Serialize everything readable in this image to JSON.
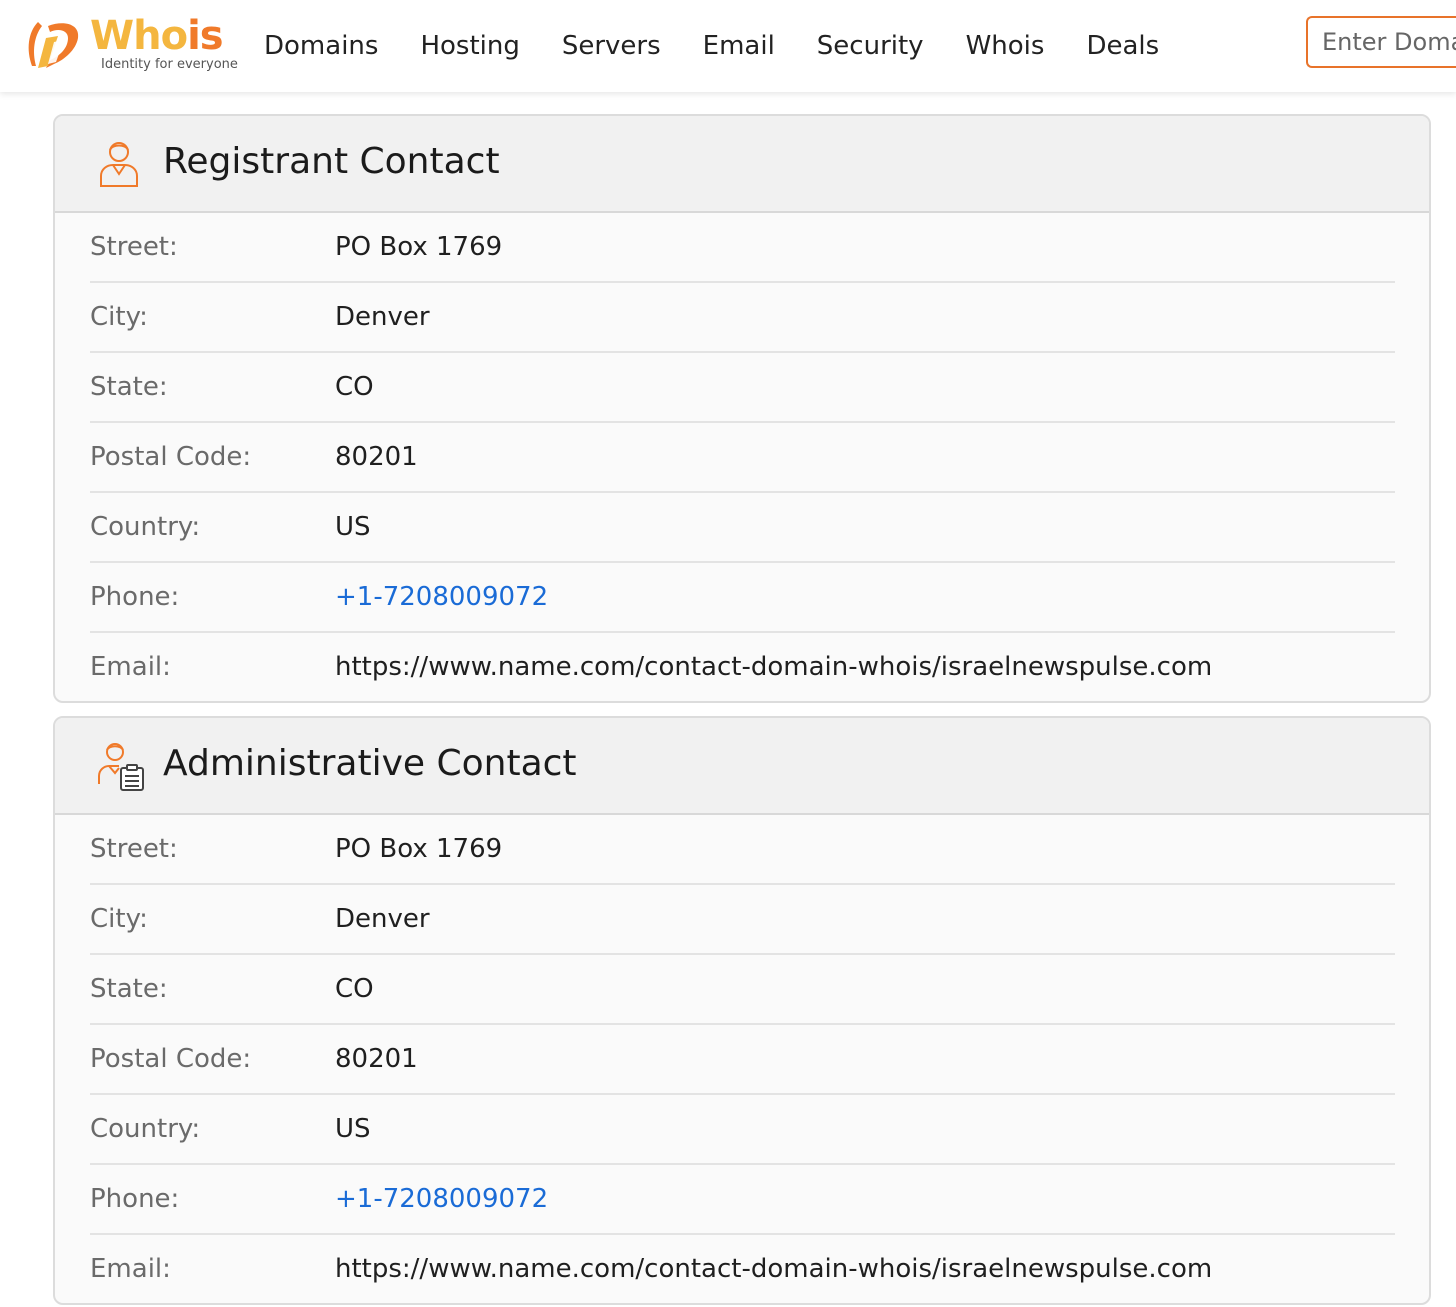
{
  "header": {
    "logo_text_main": "Who",
    "logo_text_accent": "is",
    "logo_tagline": "Identity for everyone",
    "nav": [
      "Domains",
      "Hosting",
      "Servers",
      "Email",
      "Security",
      "Whois",
      "Deals"
    ],
    "search_placeholder": "Enter Domain or IP"
  },
  "colors": {
    "accent": "#f07a2a",
    "logo_yellow": "#f4b63f",
    "link": "#1a6bd6"
  },
  "sections": [
    {
      "title": "Registrant Contact",
      "icon": "person-icon",
      "rows": [
        {
          "label": "Street:",
          "value": "PO Box 1769"
        },
        {
          "label": "City:",
          "value": "Denver"
        },
        {
          "label": "State:",
          "value": "CO"
        },
        {
          "label": "Postal Code:",
          "value": "80201"
        },
        {
          "label": "Country:",
          "value": "US"
        },
        {
          "label": "Phone:",
          "value": "+1-7208009072"
        },
        {
          "label": "Email:",
          "value": "https://www.name.com/contact-domain-whois/israelnewspulse.com"
        }
      ]
    },
    {
      "title": "Administrative Contact",
      "icon": "person-clipboard-icon",
      "rows": [
        {
          "label": "Street:",
          "value": "PO Box 1769"
        },
        {
          "label": "City:",
          "value": "Denver"
        },
        {
          "label": "State:",
          "value": "CO"
        },
        {
          "label": "Postal Code:",
          "value": "80201"
        },
        {
          "label": "Country:",
          "value": "US"
        },
        {
          "label": "Phone:",
          "value": "+1-7208009072"
        },
        {
          "label": "Email:",
          "value": "https://www.name.com/contact-domain-whois/israelnewspulse.com"
        }
      ]
    }
  ]
}
